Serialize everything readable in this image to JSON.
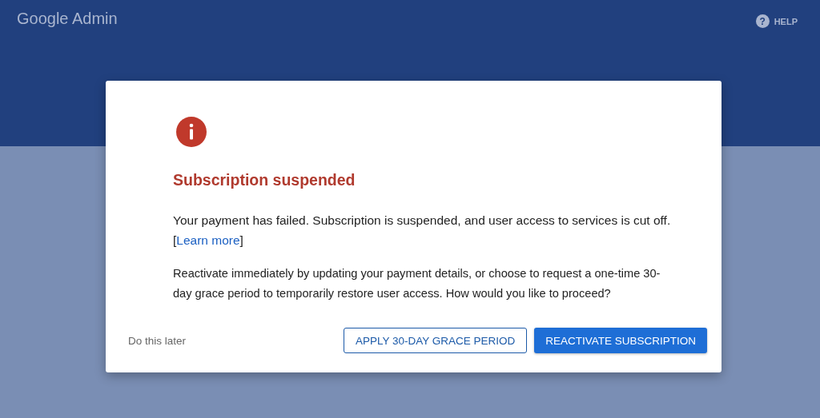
{
  "header": {
    "logo": "Google Admin",
    "help": {
      "icon": "?",
      "label": "HELP"
    }
  },
  "dialog": {
    "title": "Subscription suspended",
    "message": {
      "before": "Your payment has failed. Subscription is suspended, and user access to services is cut off. [",
      "link": "Learn more",
      "after": "]"
    },
    "detail": "Reactivate immediately by updating your payment details, or choose to request a one-time 30-day grace period to temporarily restore user access. How would you like to proceed?",
    "actions": [
      {
        "label": "Do this later",
        "kind": "text"
      },
      {
        "label": "APPLY 30-DAY GRACE PERIOD",
        "kind": "outlined"
      },
      {
        "label": "REACTIVATE SUBSCRIPTION",
        "kind": "filled"
      }
    ]
  }
}
